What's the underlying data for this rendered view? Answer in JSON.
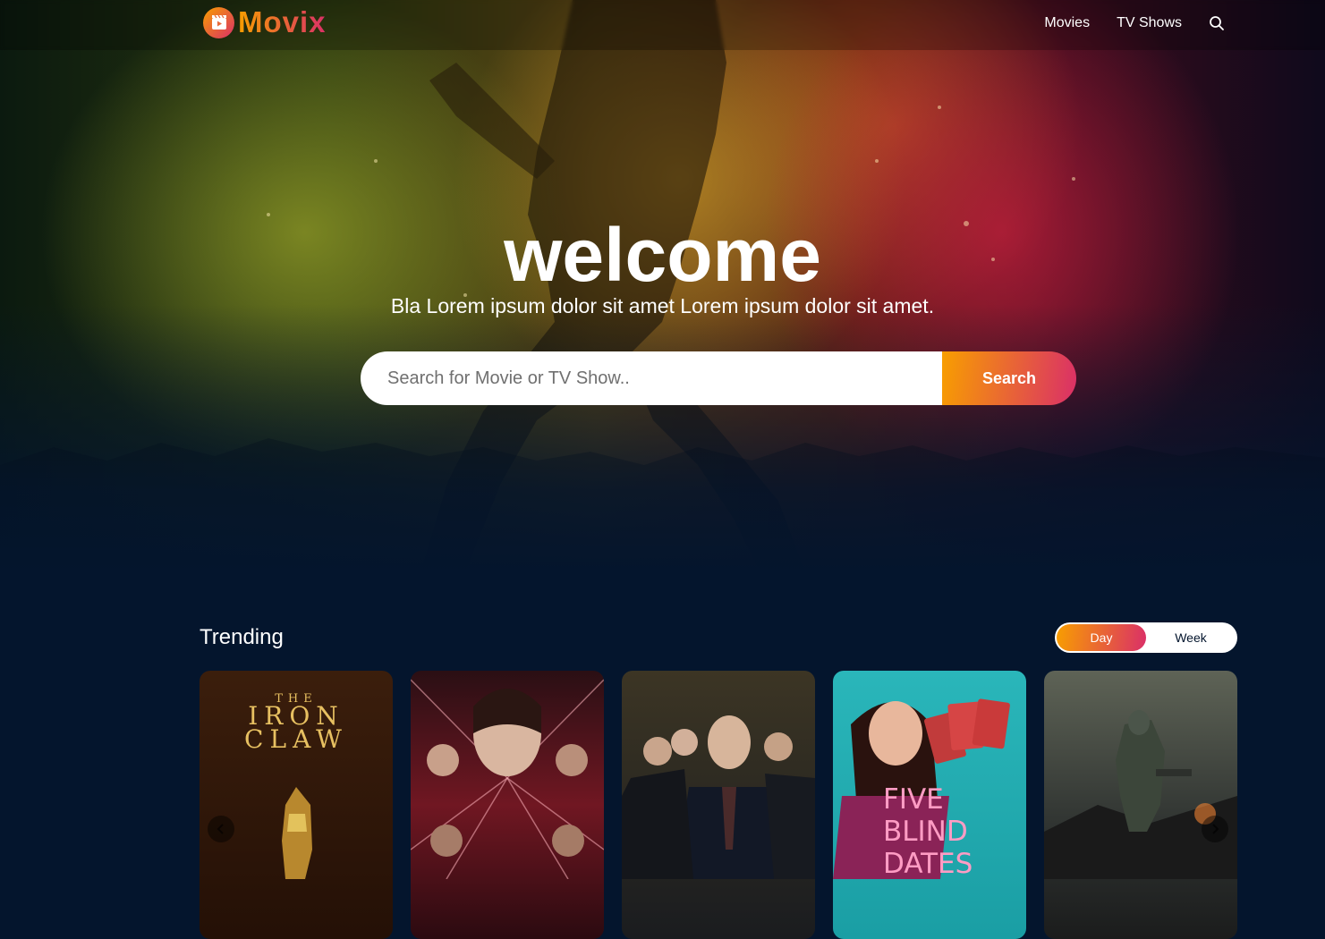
{
  "header": {
    "logo_text": "Movix",
    "nav": [
      {
        "label": "Movies"
      },
      {
        "label": "TV Shows"
      }
    ]
  },
  "hero": {
    "title": "welcome",
    "subtitle": "Bla Lorem ipsum dolor sit amet Lorem ipsum dolor sit amet.",
    "search_placeholder": "Search for Movie or TV Show..",
    "search_button": "Search"
  },
  "trending": {
    "title": "Trending",
    "tabs": [
      {
        "label": "Day",
        "active": true
      },
      {
        "label": "Week",
        "active": false
      }
    ],
    "cards": [
      {
        "poster_text_small": "THE",
        "poster_text_large": "IRON CLAW"
      },
      {
        "poster_text_small": "",
        "poster_text_large": ""
      },
      {
        "poster_text_small": "",
        "poster_text_large": ""
      },
      {
        "poster_text_small": "",
        "poster_text_large": "FIVE BLIND DATES"
      },
      {
        "poster_text_small": "",
        "poster_text_large": ""
      }
    ]
  },
  "colors": {
    "accent_start": "#f89e00",
    "accent_end": "#da2f68",
    "background": "#04152d"
  }
}
